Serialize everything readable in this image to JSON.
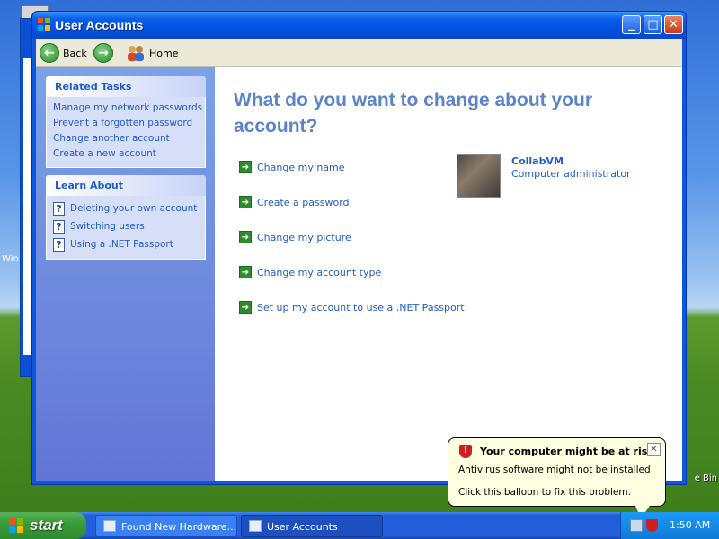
{
  "window": {
    "title": "User Accounts",
    "buttons": {
      "minimize": "_",
      "maximize": "□",
      "close": "✕"
    }
  },
  "toolbar": {
    "back_label": "Back",
    "home_label": "Home"
  },
  "sidebar": {
    "related_tasks": {
      "title": "Related Tasks",
      "items": [
        "Manage my network passwords",
        "Prevent a forgotten password",
        "Change another account",
        "Create a new account"
      ]
    },
    "learn_about": {
      "title": "Learn About",
      "items": [
        "Deleting your own account",
        "Switching users",
        "Using a .NET Passport"
      ]
    }
  },
  "main": {
    "heading": "What do you want to change about your account?",
    "tasks": [
      "Change my name",
      "Create a password",
      "Change my picture",
      "Change my account type",
      "Set up my account to use a .NET Passport"
    ],
    "account": {
      "name": "CollabVM",
      "role": "Computer administrator"
    }
  },
  "balloon": {
    "title": "Your computer might be at risk",
    "line1": "Antivirus software might not be installed",
    "line2": "Click this balloon to fix this problem."
  },
  "taskbar": {
    "start_label": "start",
    "items": [
      "Found New Hardware...",
      "User Accounts"
    ],
    "clock": "1:50 AM"
  },
  "desktop": {
    "left_fragment": "Win",
    "recycle_label": "e Bin"
  },
  "colors": {
    "link": "#215dc6",
    "heading": "#5b83c8",
    "titlebar": "#0054e3",
    "taskbar": "#245edb"
  }
}
